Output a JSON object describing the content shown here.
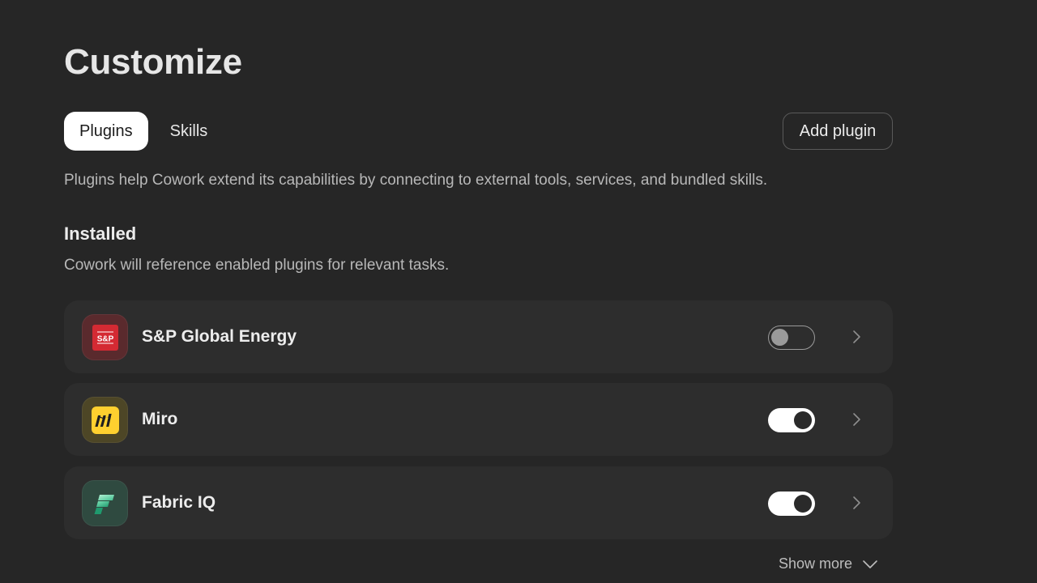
{
  "page": {
    "title": "Customize"
  },
  "tabs": [
    {
      "label": "Plugins",
      "active": true
    },
    {
      "label": "Skills",
      "active": false
    }
  ],
  "actions": {
    "add_plugin_label": "Add plugin"
  },
  "description": "Plugins help Cowork extend its capabilities by connecting to external tools, services, and bundled skills.",
  "installed": {
    "title": "Installed",
    "subtitle": "Cowork will reference enabled plugins for relevant tasks.",
    "plugins": [
      {
        "name": "S&P Global Energy",
        "icon": "sp-global-logo-icon",
        "icon_text": "S&P",
        "enabled": false
      },
      {
        "name": "Miro",
        "icon": "miro-logo-icon",
        "enabled": true
      },
      {
        "name": "Fabric IQ",
        "icon": "fabric-logo-icon",
        "enabled": true
      }
    ],
    "show_more_label": "Show more"
  },
  "colors": {
    "background": "#262626",
    "card": "#2d2d2d",
    "sp_red": "#d42a33",
    "miro_yellow": "#ffd02f",
    "fabric_green": "#3fbf8f"
  }
}
